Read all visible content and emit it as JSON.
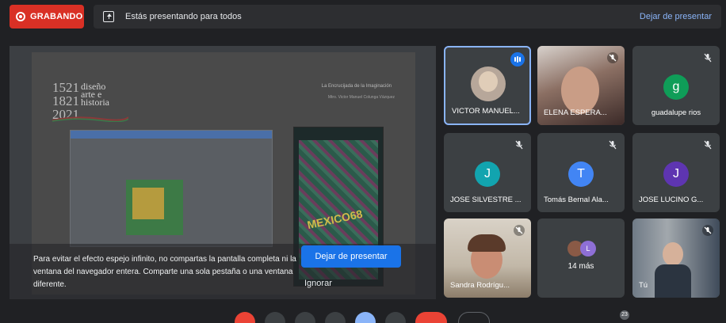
{
  "recording": {
    "label": "GRABANDO"
  },
  "banner": {
    "text": "Estás presentando para todos",
    "stop_link": "Dejar de presentar"
  },
  "slide": {
    "logo_years": "1521\n1821\n2021",
    "logo_words": "diseño\narte e\nhistoria",
    "heading": "La Encrucijada de la Imaginación",
    "subheading": "Mtro. Victor Manuel Colunga Vázquez",
    "poster_title": "MEXICO68"
  },
  "warning": {
    "text": "Para evitar el efecto espejo infinito, no compartas la pantalla completa ni la ventana del navegador entera. Comparte una sola pestaña o una ventana diferente.",
    "stop_button": "Dejar de presentar",
    "ignore_button": "Ignorar"
  },
  "participants": [
    {
      "name": "VICTOR MANUEL...",
      "type": "photo",
      "speaking": true
    },
    {
      "name": "ELENA ESPERA...",
      "type": "video",
      "muted": true
    },
    {
      "name": "guadalupe rios",
      "type": "letter",
      "letter": "g",
      "color": "#0f9d58",
      "muted": true
    },
    {
      "name": "JOSE SILVESTRE ...",
      "type": "letter",
      "letter": "J",
      "color": "#12a4af",
      "muted": true
    },
    {
      "name": "Tomás Bernal Ala...",
      "type": "letter",
      "letter": "T",
      "color": "#4285f4",
      "muted": true
    },
    {
      "name": "JOSE LUCINO G...",
      "type": "letter",
      "letter": "J",
      "color": "#5e35b1",
      "muted": true
    },
    {
      "name": "Sandra Rodrígu...",
      "type": "video",
      "muted": true
    },
    {
      "name": "14 más",
      "type": "more",
      "letter": "L"
    },
    {
      "name": "Tú",
      "type": "video",
      "muted": true
    }
  ],
  "controls": {
    "people_count": "23"
  },
  "colors": {
    "accent": "#1a73e8",
    "recording": "#d93025",
    "link": "#8ab4f8",
    "tile_bg": "#3c4043"
  }
}
